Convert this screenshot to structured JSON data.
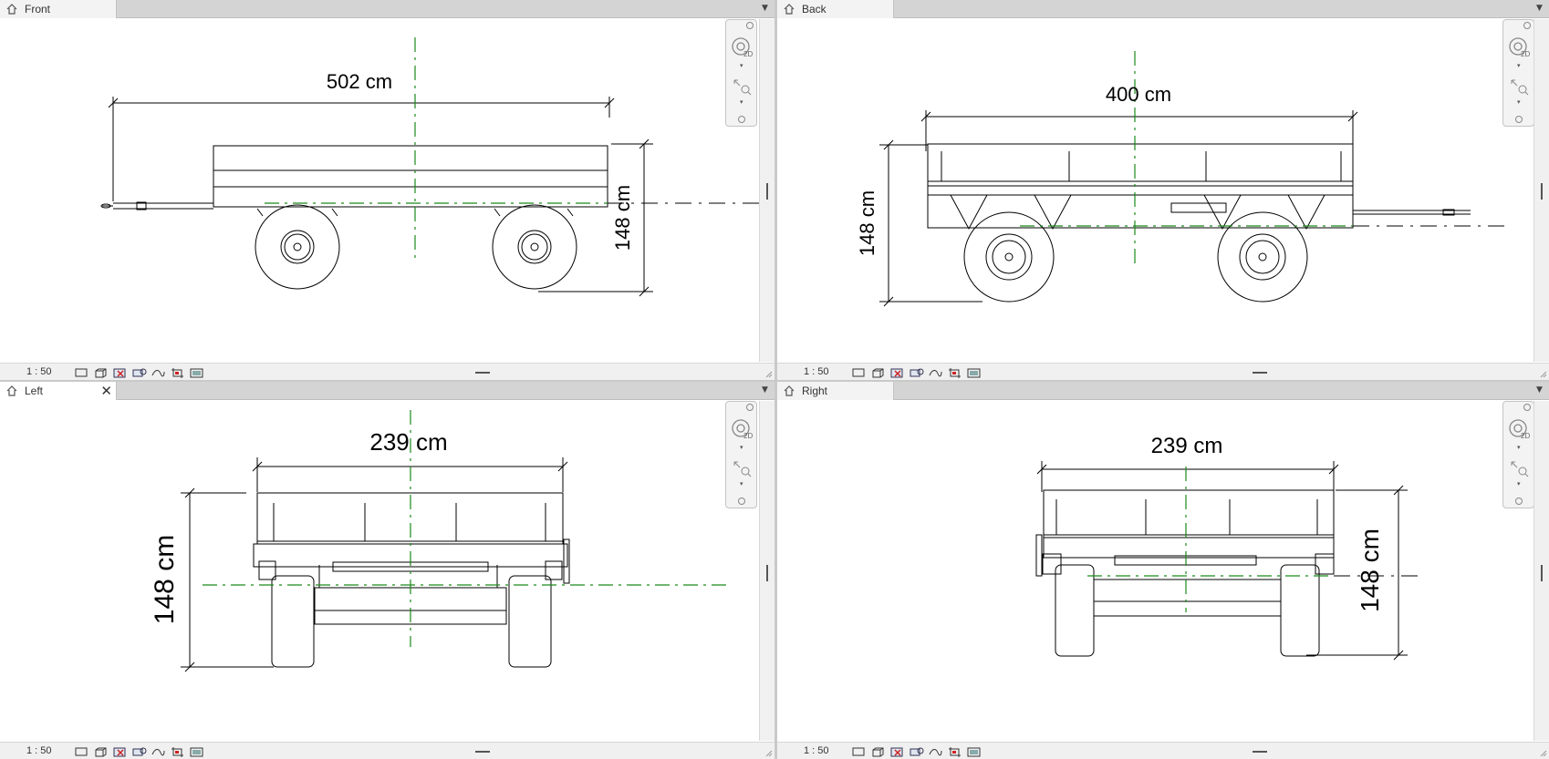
{
  "viewports": {
    "front": {
      "tab": "Front",
      "scale": "1 : 50",
      "width_dim": "502 cm",
      "height_dim": "148 cm"
    },
    "back": {
      "tab": "Back",
      "scale": "1 : 50",
      "width_dim": "400 cm",
      "height_dim": "148 cm"
    },
    "left": {
      "tab": "Left",
      "close": "✕",
      "scale": "1 : 50",
      "width_dim": "239 cm",
      "height_dim": "148 cm"
    },
    "right": {
      "tab": "Right",
      "scale": "1 : 50",
      "width_dim": "239 cm",
      "height_dim": "148 cm"
    }
  },
  "navigation_bar": {
    "wheel_label": "2D"
  },
  "view_control_icons": [
    "detail-level-icon",
    "visual-style-icon",
    "sun-path-icon",
    "shadows-icon",
    "crop-view-icon",
    "show-crop-region-icon",
    "temporary-hide-icon",
    "reveal-hidden-icon"
  ],
  "colors": {
    "centerline": "#1a8a1a",
    "line": "#000000",
    "tab_active": "#ffffff",
    "tabbar": "#d4d4d4"
  }
}
